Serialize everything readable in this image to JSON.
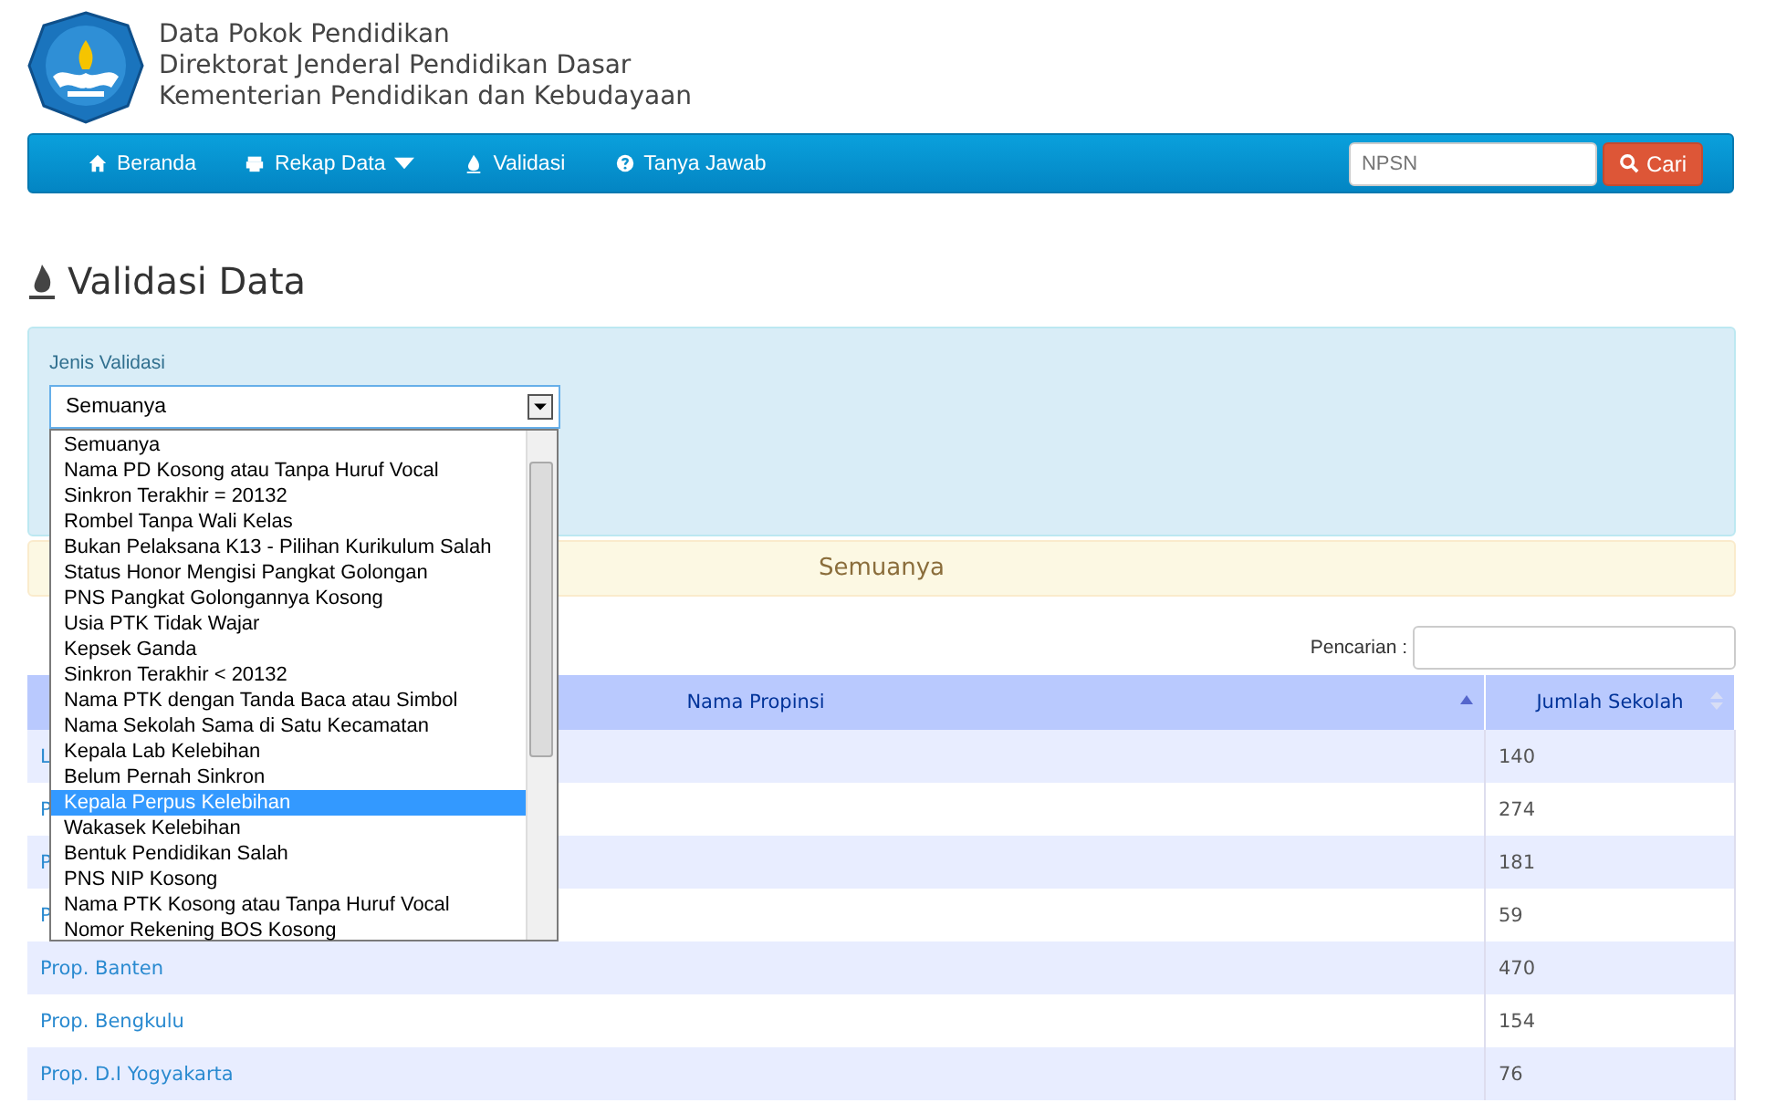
{
  "header": {
    "lines": [
      "Data Pokok Pendidikan",
      "Direktorat Jenderal Pendidikan Dasar",
      "Kementerian Pendidikan dan Kebudayaan"
    ]
  },
  "navbar": {
    "items": [
      {
        "label": "Beranda",
        "caret": false
      },
      {
        "label": "Rekap Data",
        "caret": true
      },
      {
        "label": "Validasi",
        "caret": false
      },
      {
        "label": "Tanya Jawab",
        "caret": false
      }
    ],
    "search": {
      "placeholder": "NPSN"
    },
    "search_button": "Cari"
  },
  "page_title": "Validasi Data",
  "filter": {
    "label": "Jenis Validasi",
    "value": "Semuanya",
    "options": [
      {
        "label": "Semuanya",
        "highlighted": false
      },
      {
        "label": "Nama PD Kosong atau Tanpa Huruf Vocal",
        "highlighted": false
      },
      {
        "label": "Sinkron Terakhir = 20132",
        "highlighted": false
      },
      {
        "label": "Rombel Tanpa Wali Kelas",
        "highlighted": false
      },
      {
        "label": "Bukan Pelaksana K13 - Pilihan Kurikulum Salah",
        "highlighted": false
      },
      {
        "label": "Status Honor Mengisi Pangkat Golongan",
        "highlighted": false
      },
      {
        "label": "PNS Pangkat Golongannya Kosong",
        "highlighted": false
      },
      {
        "label": "Usia PTK Tidak Wajar",
        "highlighted": false
      },
      {
        "label": "Kepsek Ganda",
        "highlighted": false
      },
      {
        "label": "Sinkron Terakhir < 20132",
        "highlighted": false
      },
      {
        "label": "Nama PTK dengan Tanda Baca atau Simbol",
        "highlighted": false
      },
      {
        "label": "Nama Sekolah Sama di Satu Kecamatan",
        "highlighted": false
      },
      {
        "label": "Kepala Lab Kelebihan",
        "highlighted": false
      },
      {
        "label": "Belum Pernah Sinkron",
        "highlighted": false
      },
      {
        "label": "Kepala Perpus Kelebihan",
        "highlighted": true
      },
      {
        "label": "Wakasek Kelebihan",
        "highlighted": false
      },
      {
        "label": "Bentuk Pendidikan Salah",
        "highlighted": false
      },
      {
        "label": "PNS NIP Kosong",
        "highlighted": false
      },
      {
        "label": "Nama PTK Kosong atau Tanpa Huruf Vocal",
        "highlighted": false
      },
      {
        "label": "Nomor Rekening BOS Kosong",
        "highlighted": false
      }
    ]
  },
  "alert": "Semuanya",
  "table": {
    "search_label": "Pencarian :",
    "columns": [
      "Nama Propinsi",
      "Jumlah Sekolah"
    ],
    "rows": [
      {
        "name": "L",
        "count": "140"
      },
      {
        "name": "P",
        "count": "274"
      },
      {
        "name": "P",
        "count": "181"
      },
      {
        "name": "P",
        "count": "59"
      },
      {
        "name": "Prop. Banten",
        "count": "470"
      },
      {
        "name": "Prop. Bengkulu",
        "count": "154"
      },
      {
        "name": "Prop. D.I Yogyakarta",
        "count": "76"
      }
    ]
  }
}
